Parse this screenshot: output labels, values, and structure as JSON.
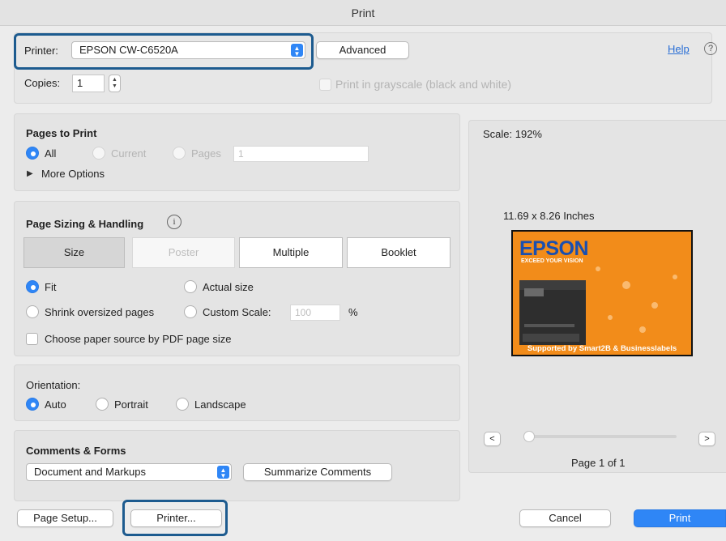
{
  "window": {
    "title": "Print"
  },
  "printer": {
    "label": "Printer:",
    "selected": "EPSON CW-C6520A",
    "advanced_label": "Advanced"
  },
  "help": {
    "label": "Help",
    "icon": "question-circle-icon"
  },
  "copies": {
    "label": "Copies:",
    "value": "1",
    "grayscale_label": "Print in grayscale (black and white)"
  },
  "pages": {
    "title": "Pages to Print",
    "all_label": "All",
    "current_label": "Current",
    "pages_label": "Pages",
    "pages_value": "1",
    "more_options_label": "More Options"
  },
  "sizing": {
    "title": "Page Sizing & Handling",
    "tabs": [
      "Size",
      "Poster",
      "Multiple",
      "Booklet"
    ],
    "fit_label": "Fit",
    "actual_label": "Actual size",
    "shrink_label": "Shrink oversized pages",
    "custom_label": "Custom Scale:",
    "custom_value": "100",
    "percent": "%",
    "paper_source_label": "Choose paper source by PDF page size"
  },
  "orientation": {
    "title": "Orientation:",
    "auto": "Auto",
    "portrait": "Portrait",
    "landscape": "Landscape"
  },
  "comments": {
    "title": "Comments & Forms",
    "selected": "Document and Markups",
    "summarize_label": "Summarize Comments"
  },
  "preview": {
    "scale": "Scale: 192%",
    "dimensions": "11.69 x 8.26 Inches",
    "brand": "EPSON",
    "tagline": "EXCEED YOUR VISION",
    "footer": "Supported by Smart2B & Businesslabels",
    "prev": "<",
    "next": ">",
    "page_info": "Page 1 of 1"
  },
  "footer": {
    "page_setup": "Page Setup...",
    "printer": "Printer...",
    "cancel": "Cancel",
    "print": "Print"
  },
  "colors": {
    "accent": "#2f86f6",
    "highlight": "#1d5b8f",
    "preview_bg": "#f28c1a"
  }
}
